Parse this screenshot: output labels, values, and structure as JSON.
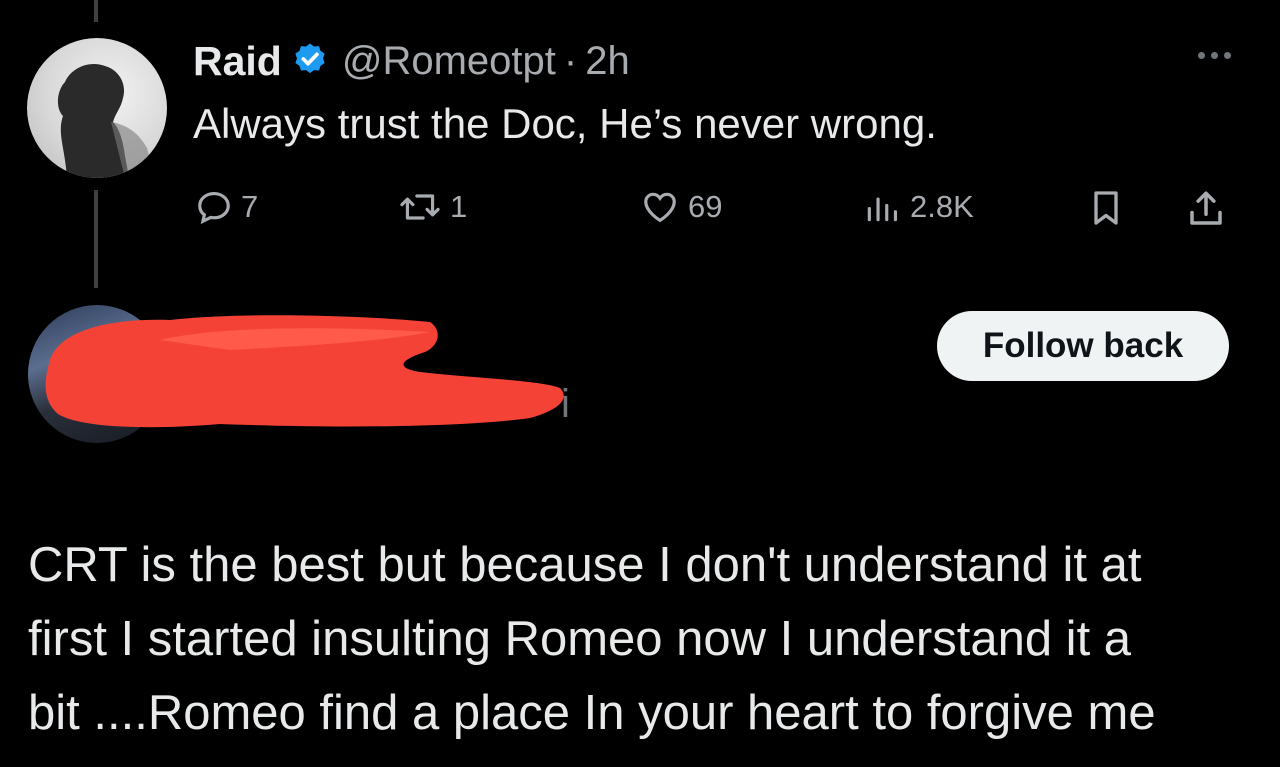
{
  "tweet": {
    "author_name": "Raid",
    "handle": "@Romeotpt",
    "separator": "·",
    "time": "2h",
    "text": "Always trust the Doc, He’s never wrong.",
    "verified_color": "#1d9bf0",
    "actions": {
      "replies": "7",
      "retweets": "1",
      "likes": "69",
      "views": "2.8K"
    }
  },
  "reply": {
    "follow_back_label": "Follow back",
    "handle_visible_tail": "i",
    "redaction_color": "#f44336",
    "text_lines": [
      "CRT is the best but because I don't understand it at",
      "first I started insulting Romeo now I understand it a",
      "bit ....Romeo find a place In your heart to forgive me"
    ]
  },
  "icons": [
    "more-icon",
    "verified-icon",
    "reply-icon",
    "retweet-icon",
    "like-icon",
    "views-icon",
    "bookmark-icon",
    "share-icon"
  ]
}
